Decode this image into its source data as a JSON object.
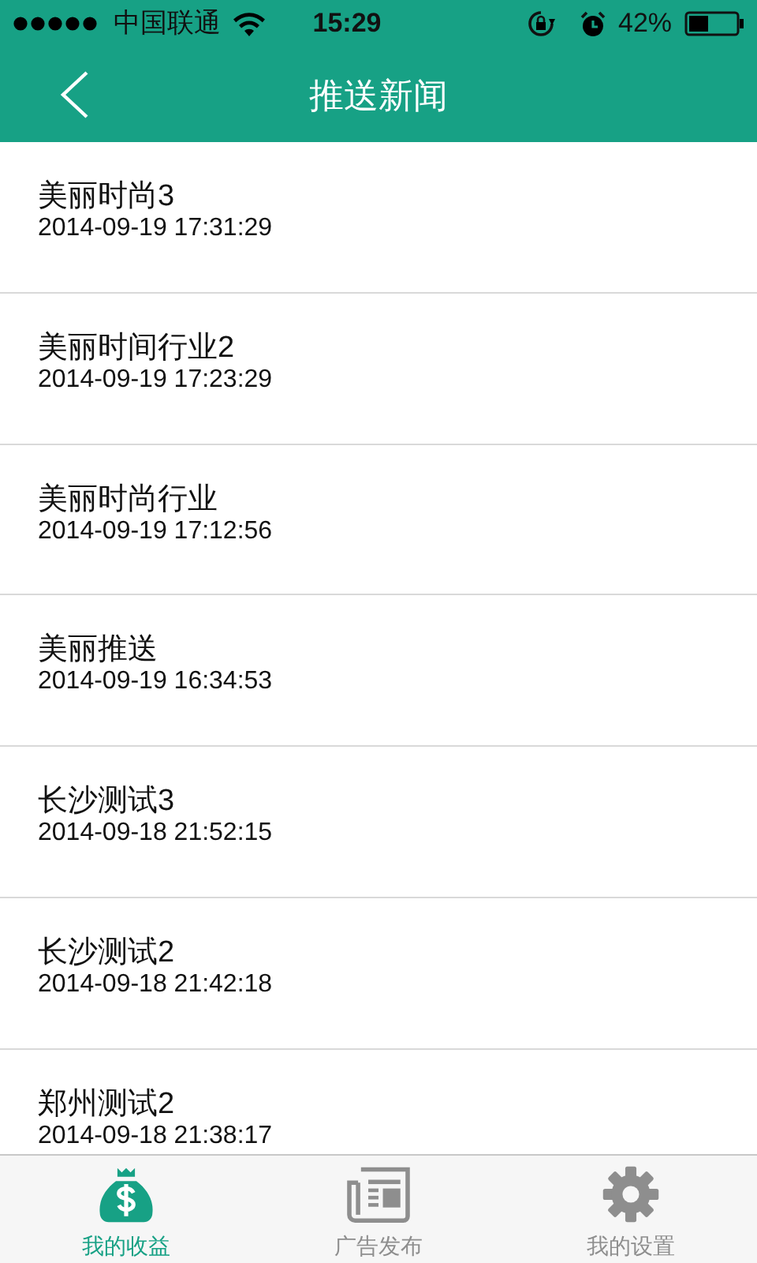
{
  "status_bar": {
    "carrier": "中国联通",
    "time": "15:29",
    "battery": "42%"
  },
  "nav_bar": {
    "title": "推送新闻"
  },
  "news": [
    {
      "title": "美丽时尚3",
      "time": "2014-09-19 17:31:29"
    },
    {
      "title": "美丽时间行业2",
      "time": "2014-09-19 17:23:29"
    },
    {
      "title": "美丽时尚行业",
      "time": "2014-09-19 17:12:56"
    },
    {
      "title": "美丽推送",
      "time": "2014-09-19 16:34:53"
    },
    {
      "title": "长沙测试3",
      "time": "2014-09-18 21:52:15"
    },
    {
      "title": "长沙测试2",
      "time": "2014-09-18 21:42:18"
    },
    {
      "title": "郑州测试2",
      "time": "2014-09-18 21:38:17"
    }
  ],
  "tab_bar": [
    {
      "label": "我的收益",
      "kind": "money",
      "selected": true
    },
    {
      "label": "广告发布",
      "kind": "newspaper",
      "selected": false
    },
    {
      "label": "我的设置",
      "kind": "gear",
      "selected": false
    }
  ]
}
